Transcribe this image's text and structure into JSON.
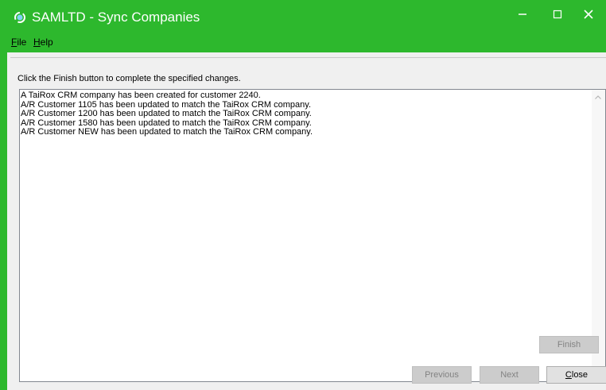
{
  "window": {
    "title": "SAMLTD - Sync Companies",
    "accent_color": "#2db82d",
    "controls": {
      "minimize": "minimize-icon",
      "maximize": "maximize-icon",
      "close": "close-icon"
    }
  },
  "menu": {
    "file_first": "F",
    "file_rest": "ile",
    "help_first": "H",
    "help_rest": "elp"
  },
  "main": {
    "instruction": "Click the Finish button to complete the specified changes.",
    "log": [
      "A TaiRox CRM company has been created for customer 2240.",
      "A/R Customer 1105 has been updated to match the TaiRox CRM company.",
      "A/R Customer 1200 has been updated to match the TaiRox CRM company.",
      "A/R Customer 1580 has been updated to match the TaiRox CRM company.",
      "A/R Customer NEW has been updated to match the TaiRox CRM company."
    ]
  },
  "buttons": {
    "finish": "Finish",
    "previous": "Previous",
    "next": "Next",
    "close_first": "C",
    "close_rest": "lose"
  }
}
